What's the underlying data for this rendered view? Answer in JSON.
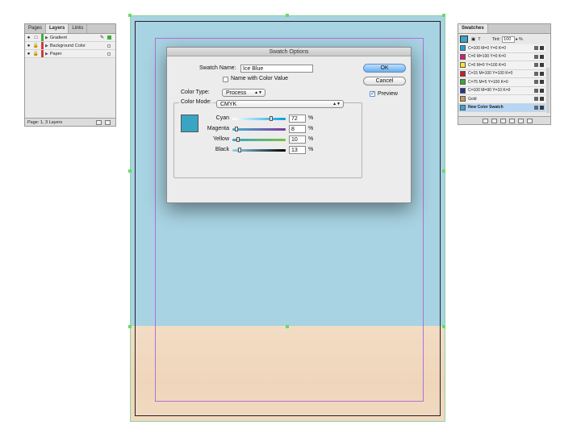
{
  "layers_panel": {
    "tabs": [
      "Pages",
      "Layers",
      "Links"
    ],
    "active_tab": "Layers",
    "layers": [
      {
        "name": "Gradient",
        "color": "#3fae3f"
      },
      {
        "name": "Background Color",
        "color": "#d13c3c"
      },
      {
        "name": "Paper",
        "color": "#d13c3c"
      }
    ],
    "status": "Page: 1, 3 Layers"
  },
  "swatches_panel": {
    "title": "Swatches",
    "tint_label": "Tint:",
    "tint_value": "100",
    "tint_unit": "%",
    "swatches": [
      {
        "name": "C=100 M=0 Y=0 K=0",
        "color": "#1aa3e0"
      },
      {
        "name": "C=0 M=100 Y=0 K=0",
        "color": "#e0157a"
      },
      {
        "name": "C=0 M=0 Y=100 K=0",
        "color": "#f4ec1e"
      },
      {
        "name": "C=15 M=100 Y=100 K=0",
        "color": "#c71f25"
      },
      {
        "name": "C=75 M=5 Y=100 K=0",
        "color": "#3ea53a"
      },
      {
        "name": "C=100 M=90 Y=10 K=0",
        "color": "#25358c"
      },
      {
        "name": "Gold",
        "color": "#c79a5b"
      },
      {
        "name": "New Color Swatch",
        "color": "#3da4c4"
      }
    ],
    "selected_index": 7
  },
  "dialog": {
    "title": "Swatch Options",
    "swatch_name_label": "Swatch Name:",
    "swatch_name_value": "Ice Blue",
    "name_with_color_value_label": "Name with Color Value",
    "color_type_label": "Color Type:",
    "color_type_value": "Process",
    "color_mode_label": "Color Mode:",
    "color_mode_value": "CMYK",
    "preview_color": "#3aa4c4",
    "ok_label": "OK",
    "cancel_label": "Cancel",
    "preview_label": "Preview",
    "preview_checked": true,
    "channels": [
      {
        "name": "Cyan",
        "value": "72",
        "unit": "%",
        "level": 0.72,
        "color_from": "#ffffff",
        "color_to": "#00a0e0"
      },
      {
        "name": "Magenta",
        "value": "8",
        "unit": "%",
        "level": 0.08,
        "color_from": "#45b0d0",
        "color_to": "#7a3a9a"
      },
      {
        "name": "Yellow",
        "value": "10",
        "unit": "%",
        "level": 0.1,
        "color_from": "#3aa4c8",
        "color_to": "#7abf3a"
      },
      {
        "name": "Black",
        "value": "13",
        "unit": "%",
        "level": 0.13,
        "color_from": "#8fd8ee",
        "color_to": "#000000"
      }
    ]
  }
}
